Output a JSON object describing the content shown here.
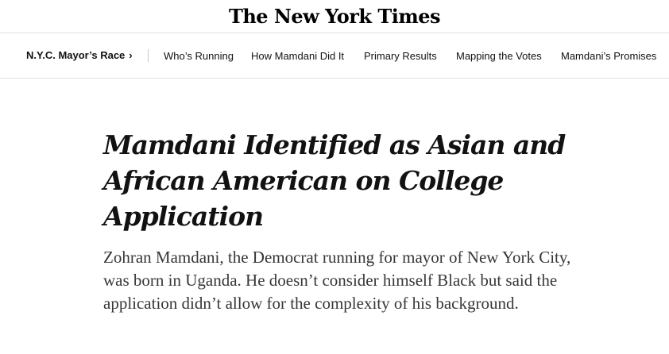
{
  "masthead": {
    "logo_text": "The New York Times"
  },
  "subnav": {
    "section_label": "N.Y.C. Mayor’s Race",
    "chevron": "›",
    "links": [
      "Who’s Running",
      "How Mamdani Did It",
      "Primary Results",
      "Mapping the Votes",
      "Mamdani’s Promises"
    ]
  },
  "article": {
    "headline": "Mamdani Identified as Asian and African American on College Application",
    "summary": "Zohran Mamdani, the Democrat running for mayor of New York City, was born in Uganda. He doesn’t consider himself Black but said the application didn’t allow for the complexity of his background."
  }
}
